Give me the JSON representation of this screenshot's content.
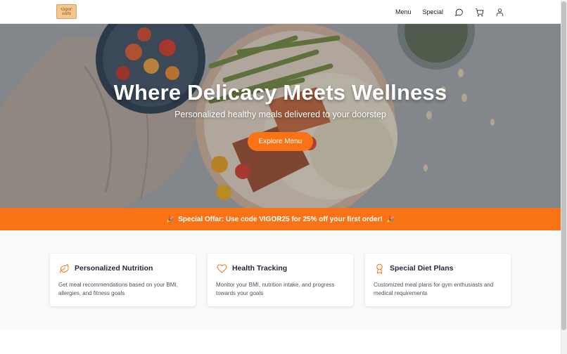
{
  "brand": {
    "logo_line1": "vigor",
    "logo_line2": "eats"
  },
  "nav": {
    "links": [
      {
        "label": "Menu"
      },
      {
        "label": "Special"
      }
    ],
    "icons": [
      "chat-icon",
      "cart-icon",
      "user-icon"
    ]
  },
  "hero": {
    "title": "Where Delicacy Meets Wellness",
    "subtitle": "Personalized healthy meals delivered to your doorstep",
    "cta_label": "Explore Menu"
  },
  "offer": {
    "text": "Special Offar: Use code VIGOR25 for 25% off your first order!",
    "icon": "party-popper-icon"
  },
  "features": [
    {
      "icon": "leaf-icon",
      "title": "Personalized Nutrition",
      "description": "Get meal recommendations based on your BMI, allergies, and fitness goals"
    },
    {
      "icon": "heart-icon",
      "title": "Health Tracking",
      "description": "Monitor your BMI, nutrition intake, and progress towards your goals"
    },
    {
      "icon": "award-icon",
      "title": "Special Diet Plans",
      "description": "Customized meal plans for gym enthusiasts and medical requirements"
    }
  ],
  "colors": {
    "accent": "#f97316",
    "text": "#1f2937",
    "muted": "#4b5563",
    "section_bg": "#f8f9fb"
  }
}
